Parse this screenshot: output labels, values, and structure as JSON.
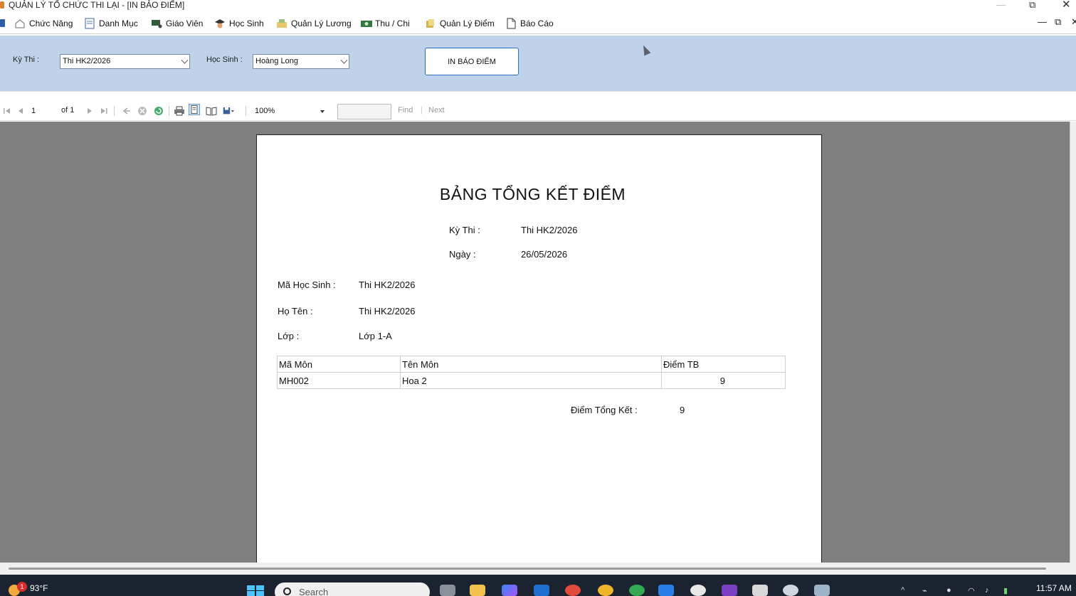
{
  "window": {
    "title": "QUẢN LÝ TỔ CHỨC THI LẠI - [IN BẢO ĐIỂM]",
    "minimize": "—",
    "maximize": "⧉",
    "close": "✕"
  },
  "menu": {
    "items": [
      {
        "label": "Chức Năng",
        "icon": "home-icon"
      },
      {
        "label": "Danh Mục",
        "icon": "document-icon"
      },
      {
        "label": "Giáo Viên",
        "icon": "teacher-icon"
      },
      {
        "label": "Học Sinh",
        "icon": "student-icon"
      },
      {
        "label": "Quản Lý Lương",
        "icon": "salary-icon"
      },
      {
        "label": "Thu / Chi",
        "icon": "money-icon"
      },
      {
        "label": "Quản Lý Điểm",
        "icon": "grade-icon"
      },
      {
        "label": "Báo Cáo",
        "icon": "report-icon"
      }
    ],
    "mdi_min": "—",
    "mdi_restore": "⧉",
    "mdi_close": "✕"
  },
  "filters": {
    "exam_label": "Kỳ Thi :",
    "exam_value": "Thi HK2/2026",
    "student_label": "Học Sinh :",
    "student_value": "Hoàng Long",
    "print_button": "IN BÁO ĐIỂM"
  },
  "report_toolbar": {
    "page_current": "1",
    "page_of": "of 1",
    "zoom": "100%",
    "find_label": "Find",
    "sep": "|",
    "next_label": "Next"
  },
  "report": {
    "title": "BẢNG TỔNG KẾT ĐIỂM",
    "exam_label": "Kỳ Thi :",
    "exam_value": "Thi HK2/2026",
    "date_label": "Ngày :",
    "date_value": "26/05/2026",
    "student_id_label": "Mã Học Sinh :",
    "student_id_value": "Thi HK2/2026",
    "name_label": "Họ Tên :",
    "name_value": "Thi HK2/2026",
    "class_label": "Lớp :",
    "class_value": "Lớp 1-A",
    "table": {
      "headers": [
        "Mã Môn",
        "Tên Môn",
        "Điểm TB"
      ],
      "rows": [
        [
          "MH002",
          "Hoa 2",
          "9"
        ]
      ]
    },
    "total_label": "Điểm Tổng Kết :",
    "total_value": "9"
  },
  "taskbar": {
    "weather_badge": "1",
    "temperature": "93°F",
    "search_placeholder": "Search",
    "time": "11:57 AM"
  },
  "colors": {
    "filter_panel": "#bed3ea",
    "viewer_bg": "#808080",
    "print_button_border": "#2d6fc4",
    "taskbar": "#1b2230"
  }
}
